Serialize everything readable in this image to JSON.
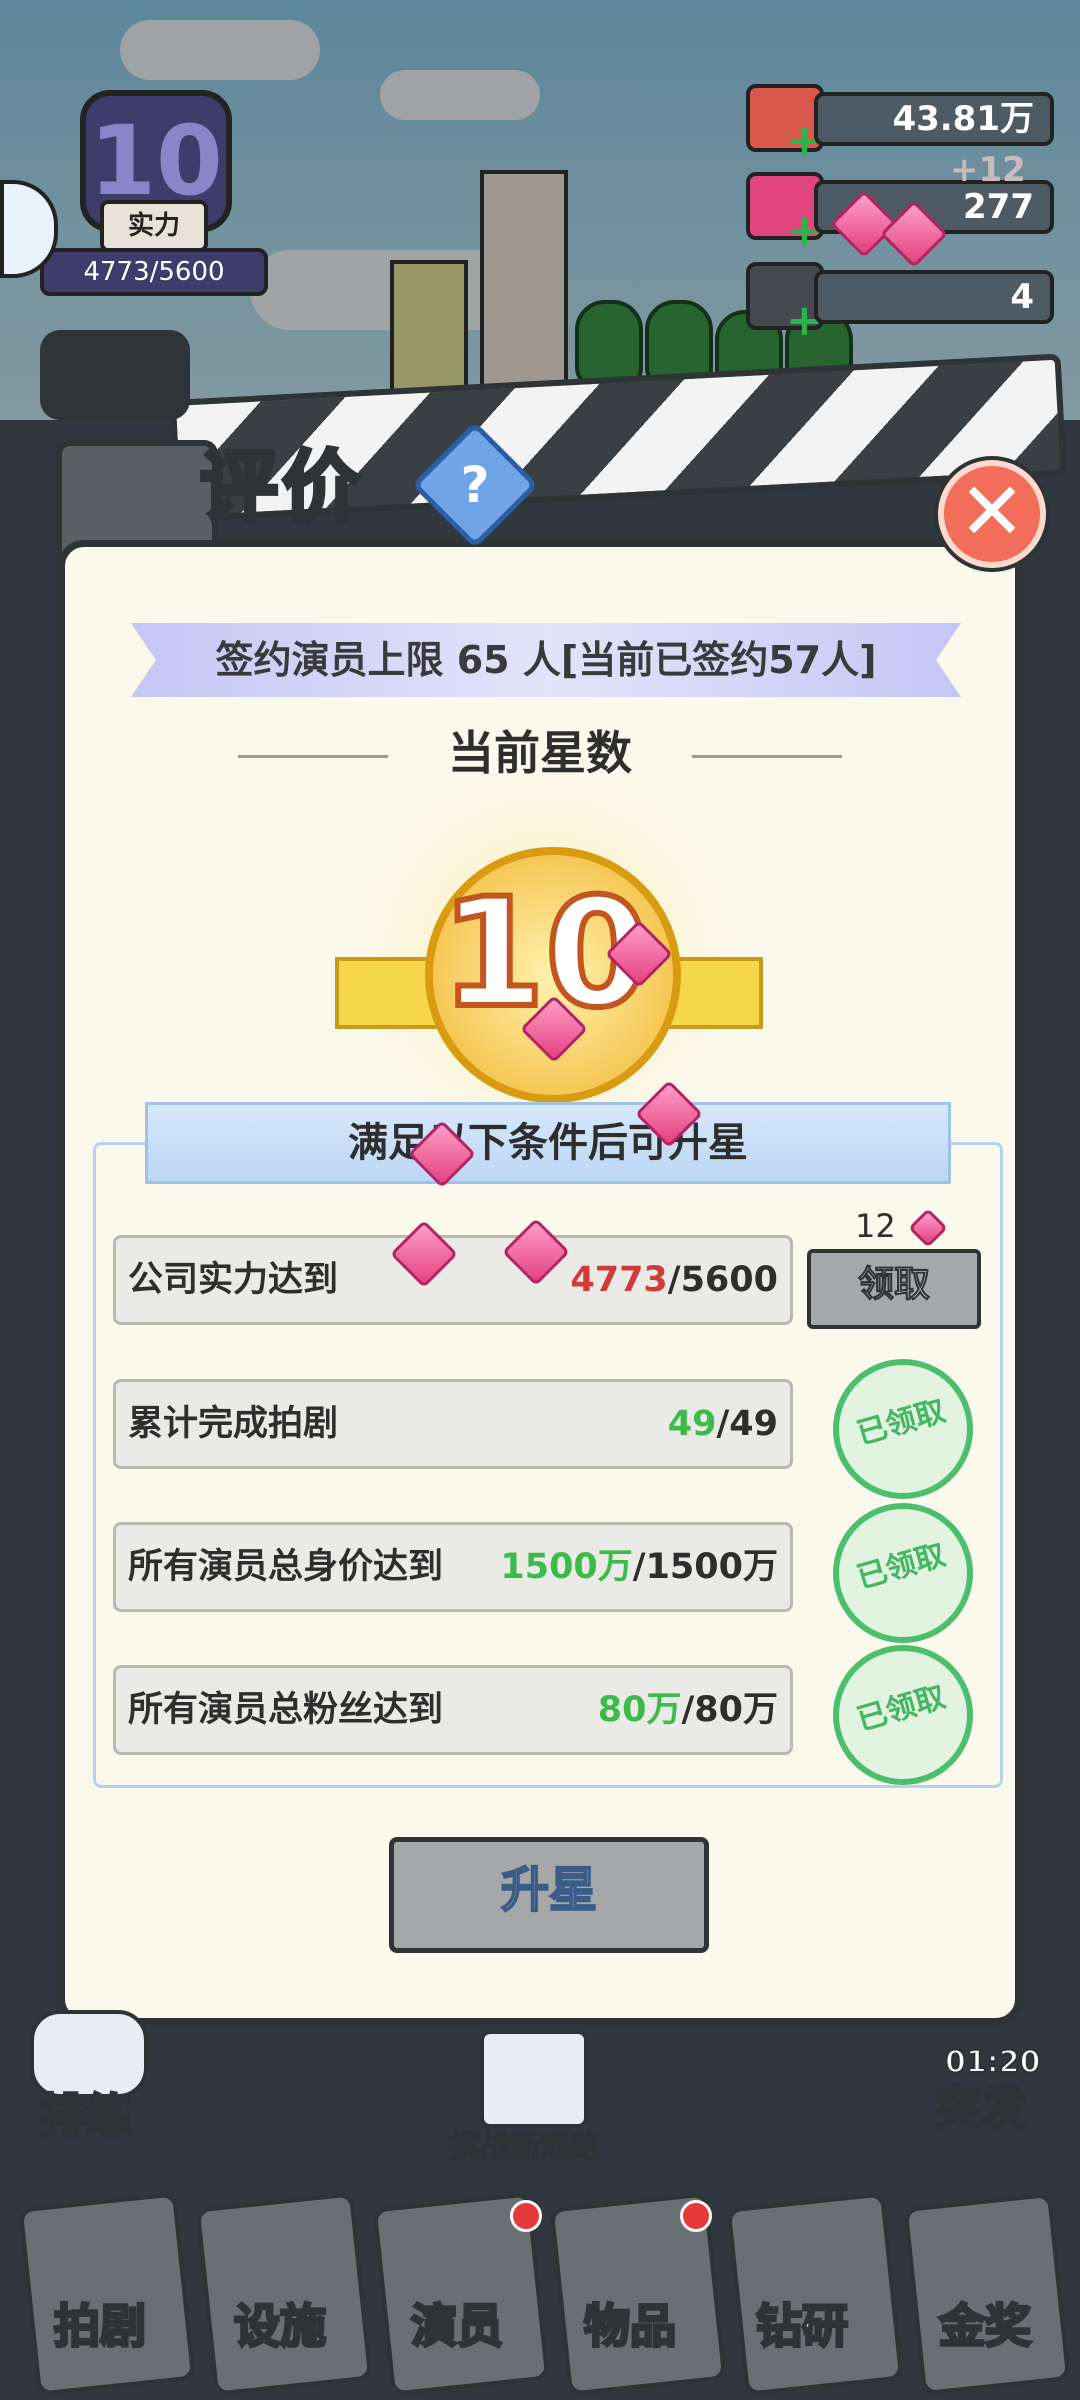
{
  "resources": {
    "cash": "43.81万",
    "gems": "277",
    "gems_bonus": "+12",
    "tickets": "4"
  },
  "level_badge": {
    "level": "10",
    "label": "实力",
    "progress": "4773/5600"
  },
  "modal": {
    "title": "评价",
    "help_symbol": "?",
    "close_symbol": "✕",
    "contract_banner": "签约演员上限 65 人[当前已签约57人]",
    "current_stars_label": "当前星数",
    "current_stars_value": "10",
    "conditions_header": "满足以下条件后可升星",
    "conditions": [
      {
        "label": "公司实力达到",
        "current": "4773",
        "target": "/5600",
        "status": "claim",
        "current_color": "#cf3b3b",
        "reward": "12",
        "action_label": "领取"
      },
      {
        "label": "累计完成拍剧",
        "current": "49",
        "target": "/49",
        "status": "claimed",
        "current_color": "#3dbb4a",
        "action_label": "已领取"
      },
      {
        "label": "所有演员总身价达到",
        "current": "1500万",
        "target": "/1500万",
        "status": "claimed",
        "current_color": "#3dbb4a",
        "action_label": "已领取"
      },
      {
        "label": "所有演员总粉丝达到",
        "current": "80万",
        "target": "/80万",
        "status": "claimed",
        "current_color": "#3dbb4a",
        "action_label": "已领取"
      }
    ],
    "upgrade_button": "升星"
  },
  "side": {
    "rehearsal": "排练",
    "challenge": "挑战新戏路",
    "burst_timer": "01:20",
    "burst": "突发"
  },
  "bottom_nav": [
    {
      "label": "拍剧",
      "badge": false
    },
    {
      "label": "设施",
      "badge": false
    },
    {
      "label": "演员",
      "badge": true
    },
    {
      "label": "物品",
      "badge": true
    },
    {
      "label": "钻研",
      "badge": false
    },
    {
      "label": "金奖",
      "badge": false
    }
  ],
  "colors": {
    "accent_red": "#cf3b3b",
    "accent_green": "#3dbb4a",
    "panel": "#fbf8ec",
    "close": "#f26d5a"
  }
}
